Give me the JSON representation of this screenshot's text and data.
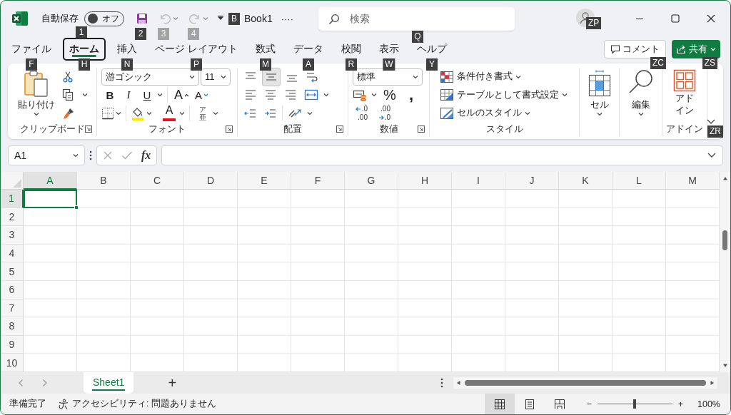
{
  "title_bar": {
    "autosave": {
      "label": "自動保存",
      "on": false,
      "state_label": "オフ",
      "keytip": "1"
    },
    "quick_access": [
      {
        "kind": "save",
        "disabled": false,
        "keytip": "2"
      },
      {
        "kind": "undo",
        "disabled": true,
        "keytip": "3"
      },
      {
        "kind": "redo",
        "disabled": true,
        "keytip": "4"
      }
    ],
    "document": {
      "keytip": "B",
      "name": "Book1",
      "more": "····"
    },
    "search": {
      "placeholder": "検索",
      "keytip": "Q"
    },
    "account": {
      "keytip": "ZP"
    }
  },
  "tabs": [
    {
      "label": "ファイル",
      "selected": false,
      "keytip": "F"
    },
    {
      "label": "ホーム",
      "selected": true,
      "keytip": "H"
    },
    {
      "label": "挿入",
      "selected": false,
      "keytip": "N"
    },
    {
      "label": "ページ レイアウト",
      "selected": false,
      "keytip": "P"
    },
    {
      "label": "数式",
      "selected": false,
      "keytip": "M"
    },
    {
      "label": "データ",
      "selected": false,
      "keytip": "A"
    },
    {
      "label": "校閲",
      "selected": false,
      "keytip": "R"
    },
    {
      "label": "表示",
      "selected": false,
      "keytip": "W"
    },
    {
      "label": "ヘルプ",
      "selected": false,
      "keytip": "Y"
    }
  ],
  "comment_button": {
    "label": "コメント",
    "keytip": "ZC"
  },
  "share_button": {
    "label": "共有",
    "keytip": "ZS"
  },
  "ribbon": {
    "clipboard": {
      "label": "クリップボード",
      "paste": "貼り付け"
    },
    "font": {
      "label": "フォント",
      "font_name": "游ゴシック",
      "font_size": "11",
      "bold": "B",
      "italic": "I",
      "underline": "U",
      "grow": "A",
      "shrink": "A",
      "font_color": "A",
      "phonetic": "ア亜"
    },
    "alignment": {
      "label": "配置",
      "vertical": [
        {
          "kind": "top",
          "selected": false
        },
        {
          "kind": "middle",
          "selected": true
        },
        {
          "kind": "bottom",
          "selected": false
        }
      ]
    },
    "number": {
      "label": "数値",
      "format": "標準",
      "percent": "%",
      "comma": ",",
      "decimals": [
        {
          "kind": "increase",
          "top": ".0",
          "bottom": ".00"
        },
        {
          "kind": "decrease",
          "top": ".00",
          "bottom": ".0"
        }
      ]
    },
    "styles": {
      "label": "スタイル",
      "items": [
        "条件付き書式",
        "テーブルとして書式設定",
        "セルのスタイル"
      ]
    },
    "cells": {
      "label": "セル"
    },
    "editing": {
      "label": "編集"
    },
    "addins": {
      "button": "アドイン",
      "label": "アドイン"
    },
    "collapse_keytip": "ZR"
  },
  "formula_bar": {
    "name_box": "A1",
    "fx": "fx"
  },
  "grid": {
    "columns": [
      {
        "label": "A",
        "selected": true
      },
      {
        "label": "B",
        "selected": false
      },
      {
        "label": "C",
        "selected": false
      },
      {
        "label": "D",
        "selected": false
      },
      {
        "label": "E",
        "selected": false
      },
      {
        "label": "F",
        "selected": false
      },
      {
        "label": "G",
        "selected": false
      },
      {
        "label": "H",
        "selected": false
      },
      {
        "label": "I",
        "selected": false
      },
      {
        "label": "J",
        "selected": false
      },
      {
        "label": "K",
        "selected": false
      },
      {
        "label": "L",
        "selected": false
      },
      {
        "label": "M",
        "selected": false
      }
    ],
    "rows": [
      {
        "label": "1",
        "selected": true
      },
      {
        "label": "2",
        "selected": false
      },
      {
        "label": "3",
        "selected": false
      },
      {
        "label": "4",
        "selected": false
      },
      {
        "label": "5",
        "selected": false
      },
      {
        "label": "6",
        "selected": false
      },
      {
        "label": "7",
        "selected": false
      },
      {
        "label": "8",
        "selected": false
      },
      {
        "label": "9",
        "selected": false
      },
      {
        "label": "10",
        "selected": false
      }
    ]
  },
  "sheets": [
    {
      "label": "Sheet1",
      "selected": true
    }
  ],
  "add_sheet": "+",
  "status_bar": {
    "ready": "準備完了",
    "accessibility": "アクセシビリティ: 問題ありません",
    "views": [
      {
        "kind": "normal",
        "selected": true
      },
      {
        "kind": "page_layout",
        "selected": false
      },
      {
        "kind": "page_break",
        "selected": false
      }
    ],
    "zoom": {
      "minus": "−",
      "plus": "+",
      "level": 0.5,
      "reading": "100%"
    }
  }
}
